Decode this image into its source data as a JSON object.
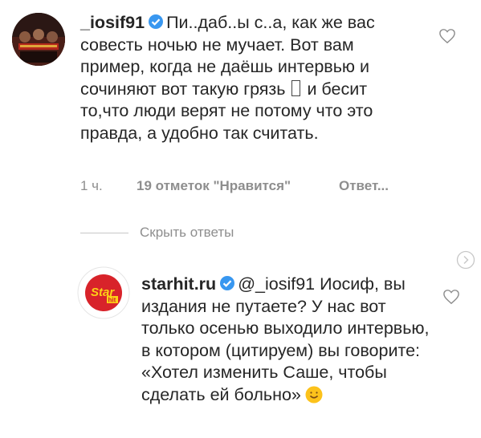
{
  "comments": [
    {
      "username": "_iosif91",
      "text_a": "Пи..даб..ы с..а, как же вас совесть ночью не мучает. Вот вам пример, когда не даёшь интервью и сочиняют вот такую грязь",
      "text_b": "и бесит то,что люди верят не потому что это правда, а удобно так считать.",
      "time": "1 ч.",
      "likes": "19 отметок \"Нравится\"",
      "reply_label": "Ответ..."
    },
    {
      "username": "starhit.ru",
      "mention": "@_iosif91",
      "text": "Иосиф, вы издания не путаете? У нас вот только осенью выходило интервью, в котором (цитируем) вы говорите: «Хотел изменить Саше, чтобы сделать ей больно»"
    }
  ],
  "hide_replies_label": "Скрыть ответы",
  "avatar2_logo": {
    "star": "Star",
    "hit": "hit"
  },
  "colors": {
    "verified_blue": "#3897f0",
    "text": "#262626",
    "meta_gray": "#8e8e8e",
    "starhit_red": "#d8232a",
    "starhit_yellow": "#fcd116"
  },
  "icons": [
    "verified-badge-icon",
    "heart-icon",
    "chevron-right-icon",
    "grimace-emoji-icon"
  ]
}
